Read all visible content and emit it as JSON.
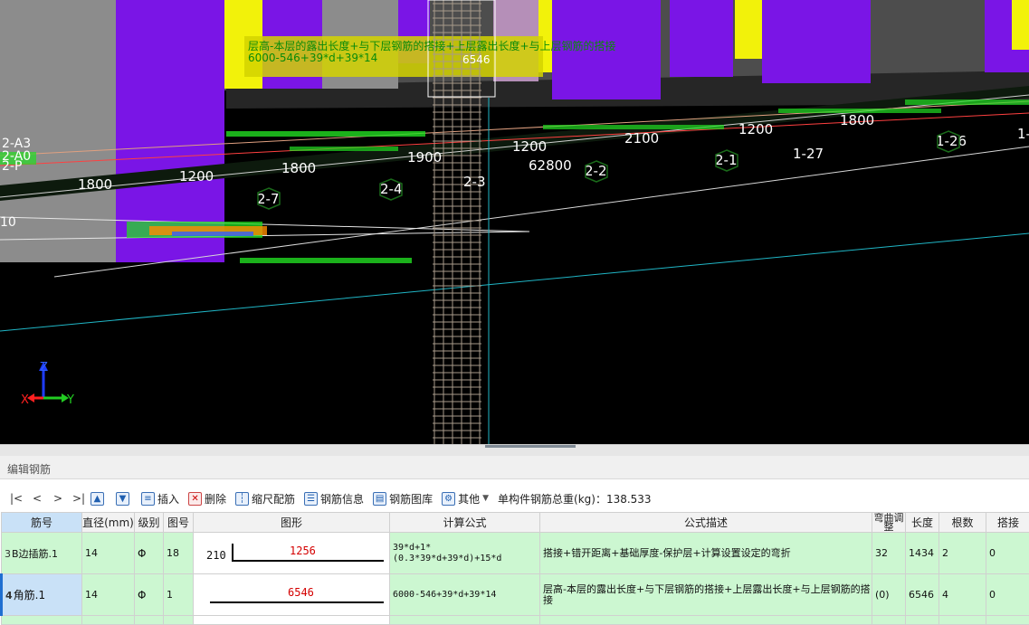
{
  "viewport": {
    "overlay_text_line1": "层高-本层的露出长度+与下层钢筋的搭接+上层露出长度+与上层钢筋的搭接",
    "overlay_text_line2": "6000-546+39*d+39*14",
    "top_value": "6546",
    "dimension_labels": [
      "1800",
      "1200",
      "1800",
      "1900",
      "1200",
      "62800",
      "2100",
      "1200",
      "1800"
    ],
    "axis_labels": [
      "2-7",
      "2-4",
      "2-3",
      "2-2",
      "2-1",
      "1-27",
      "1-26",
      "1-"
    ],
    "left_axis_labels": [
      "2-A3",
      "2-A0",
      "2-P",
      "10"
    ],
    "axis_x": "X",
    "axis_y": "Y",
    "axis_z": "Z"
  },
  "panel": {
    "title": "编辑钢筋",
    "nav": [
      "|<",
      "<",
      ">",
      ">|"
    ],
    "buttons": {
      "insert": "插入",
      "delete": "删除",
      "scale_rebar": "缩尺配筋",
      "rebar_info": "钢筋信息",
      "rebar_library": "钢筋图库",
      "other": "其他"
    },
    "total_weight": "单构件钢筋总重(kg)：138.533"
  },
  "table": {
    "headers": [
      "筋号",
      "直径(mm)",
      "级别",
      "图号",
      "图形",
      "计算公式",
      "公式描述",
      "弯曲调整",
      "长度",
      "根数",
      "搭接"
    ],
    "rows": [
      {
        "num": "3",
        "name": "B边插筋.1",
        "diameter": "14",
        "grade": "Φ",
        "fig_no": "18",
        "shape_left": "210",
        "shape_value": "1256",
        "formula": "39*d+1*(0.3*39*d+39*d)+15*d",
        "description": "搭接+错开距离+基础厚度-保护层+计算设置设定的弯折",
        "bend_adjust": "32",
        "length": "1434",
        "count": "2",
        "lap": "0"
      },
      {
        "num": "4",
        "name": "角筋.1",
        "diameter": "14",
        "grade": "Φ",
        "fig_no": "1",
        "shape_value": "6546",
        "formula": "6000-546+39*d+39*14",
        "description": "层高-本层的露出长度+与下层钢筋的搭接+上层露出长度+与上层钢筋的搭接",
        "bend_adjust": "(0)",
        "length": "6546",
        "count": "4",
        "lap": "0"
      }
    ]
  },
  "colors": {
    "viewport_bg": "#000000",
    "column_purple": "#7a15e6",
    "column_yellow": "#f2f20a",
    "wall_gray": "#8c8c8c",
    "rebar_green": "#22dd22",
    "text_white": "#ffffff",
    "cyan_line": "#20b6c6",
    "row_green": "#ccf7d1",
    "row_selected": "#c9e1f7",
    "shape_red": "#d40000"
  }
}
